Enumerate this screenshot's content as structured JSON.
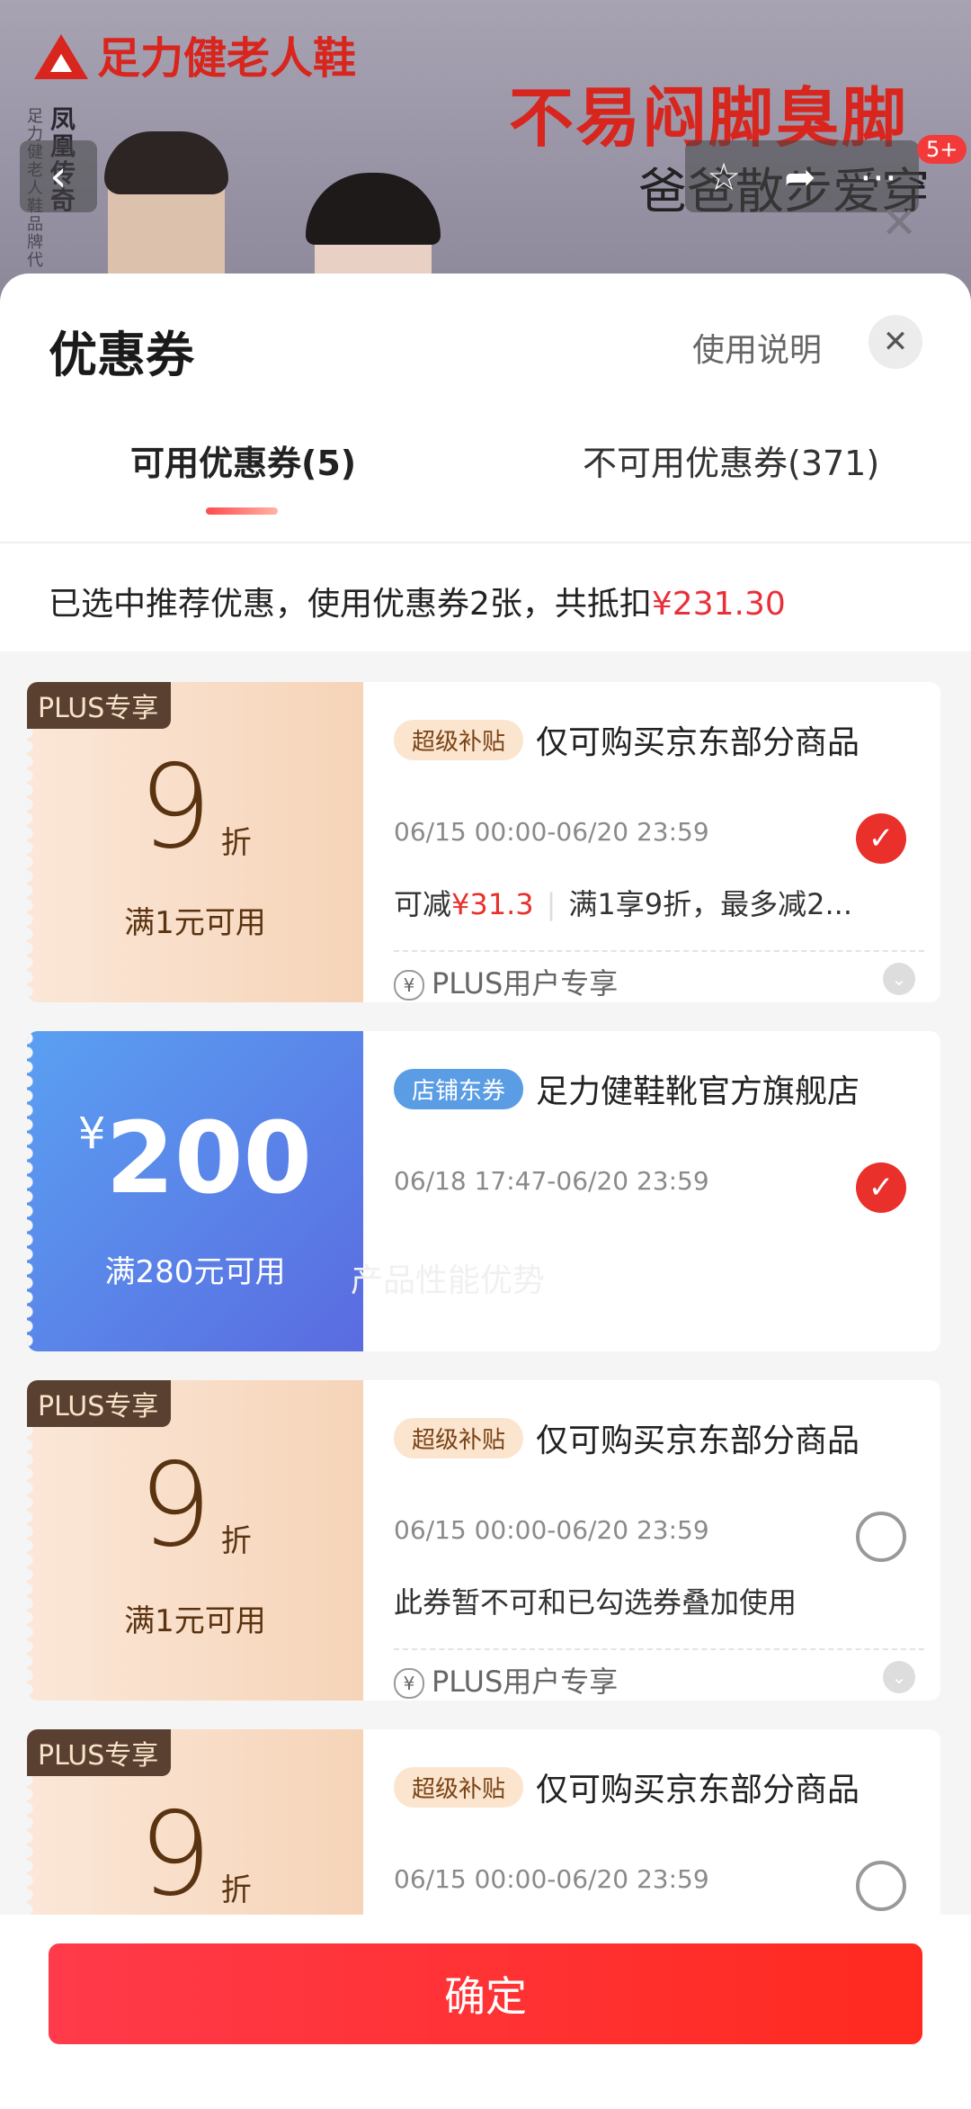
{
  "banner": {
    "brand": "足力健老人鞋",
    "vertical_text": "足力健老人鞋品牌代",
    "name": "凤凰传奇",
    "slogan1": "不易闷脚臭脚",
    "slogan2": "爸爸散步爱穿",
    "nav_badge": "5+"
  },
  "sheet": {
    "title": "优惠券",
    "help": "使用说明",
    "tabs": [
      {
        "label": "可用优惠券(5)",
        "active": true
      },
      {
        "label": "不可用优惠券(371)",
        "active": false
      }
    ],
    "summary_prefix": "已选中推荐优惠，使用优惠券2张，共抵扣",
    "summary_amount": "¥231.30"
  },
  "coupons": [
    {
      "plus_tag": "PLUS专享",
      "value": "9",
      "unit": "折",
      "condition": "满1元可用",
      "tag": "超级补贴",
      "title": "仅可购买京东部分商品",
      "time": "06/15 00:00-06/20 23:59",
      "reduce_prefix": "可减",
      "reduce_amount": "¥31.3",
      "reduce_rule": "满1享9折，最多减2...",
      "plus_user": "PLUS用户专享",
      "checked": true
    },
    {
      "currency": "¥",
      "value": "200",
      "condition": "满280元可用",
      "tag": "店铺东券",
      "title": "足力健鞋靴官方旗舰店",
      "time": "06/18 17:47-06/20 23:59",
      "checked": true
    },
    {
      "plus_tag": "PLUS专享",
      "value": "9",
      "unit": "折",
      "condition": "满1元可用",
      "tag": "超级补贴",
      "title": "仅可购买京东部分商品",
      "time": "06/15 00:00-06/20 23:59",
      "notice": "此券暂不可和已勾选券叠加使用",
      "plus_user": "PLUS用户专享",
      "checked": false
    },
    {
      "plus_tag": "PLUS专享",
      "value": "9",
      "unit": "折",
      "tag": "超级补贴",
      "title": "仅可购买京东部分商品",
      "time": "06/15 00:00-06/20 23:59",
      "checked": false
    }
  ],
  "watermark": "产品性能优势",
  "confirm_label": "确定",
  "icons": {
    "back": "chevron-left-icon",
    "star": "star-icon",
    "share": "share-icon",
    "close": "close-icon",
    "check": "check-icon",
    "yen": "yen-icon",
    "chevron_down": "chevron-down-icon"
  },
  "colors": {
    "accent_red": "#e9302b",
    "coupon_gold": "#f6d4b8",
    "coupon_blue": "#5a6be0"
  }
}
